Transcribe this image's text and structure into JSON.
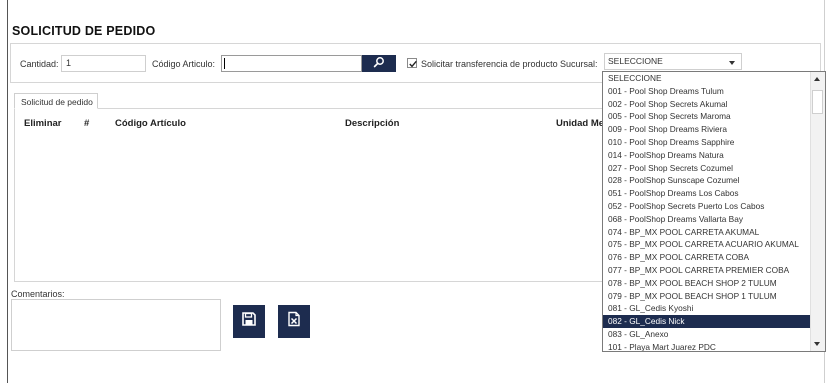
{
  "page": {
    "title": "SOLICITUD DE PEDIDO"
  },
  "form": {
    "quantity_label": "Cantidad:",
    "quantity_value": "1",
    "article_label": "Código Articulo:",
    "article_value": "",
    "transfer_label": "Solicitar transferencia de producto",
    "transfer_checked": true,
    "branch_label": "Sucursal:",
    "branch_selected": "SELECCIONE"
  },
  "tabs": [
    {
      "label": "Solicitud de pedido"
    }
  ],
  "table": {
    "headers": [
      "Eliminar",
      "#",
      "Código Artículo",
      "Descripción",
      "Unidad Me"
    ]
  },
  "comments": {
    "label": "Comentarios:",
    "value": ""
  },
  "branch_options": [
    "SELECCIONE",
    "001 - Pool Shop Dreams Tulum",
    "002 - Pool Shop Secrets Akumal",
    "005 - Pool Shop Secrets Maroma",
    "009 - Pool Shop Dreams Riviera",
    "010 - Pool Shop Dreams Sapphire",
    "014 - PoolShop Dreams Natura",
    "027 - Pool Shop Secrets Cozumel",
    "028 - PoolShop Sunscape Cozumel",
    "051 - PoolShop Dreams Los Cabos",
    "052 - PoolShop Secrets Puerto Los Cabos",
    "068 - PoolShop Dreams Vallarta Bay",
    "074 - BP_MX POOL CARRETA AKUMAL",
    "075 - BP_MX POOL CARRETA ACUARIO AKUMAL",
    "076 - BP_MX POOL CARRETA COBA",
    "077 - BP_MX POOL CARRETA PREMIER COBA",
    "078 - BP_MX POOL BEACH SHOP 2 TULUM",
    "079 - BP_MX POOL BEACH SHOP 1 TULUM",
    "081 - GL_Cedis Kyoshi",
    "082 - GL_Cedis Nick",
    "083 - GL_Anexo",
    "101 - Playa Mart Juarez PDC"
  ],
  "highlighted_option_index": 19,
  "colors": {
    "accent": "#1d2c4f",
    "border": "#d6d6d6",
    "text": "#333333"
  },
  "icons": {
    "search": "search-icon",
    "save": "floppy-disk-icon",
    "clear": "document-x-icon",
    "check": "check-icon",
    "select_caret": "chevron-down-icon"
  }
}
